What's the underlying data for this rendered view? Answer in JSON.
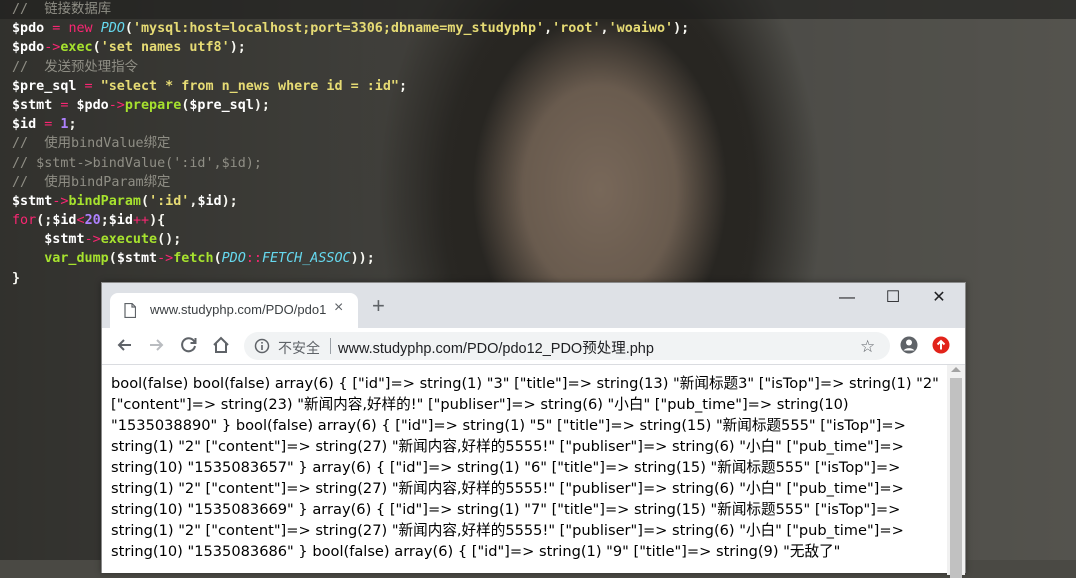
{
  "editor": {
    "lines": [
      [
        {
          "t": "//  链接数据库",
          "c": "cmt"
        }
      ],
      [
        {
          "t": "$pdo",
          "c": "var"
        },
        {
          "t": " = ",
          "c": "op"
        },
        {
          "t": "new ",
          "c": "kw"
        },
        {
          "t": "PDO",
          "c": "cls"
        },
        {
          "t": "(",
          "c": "pl"
        },
        {
          "t": "'mysql:host=localhost;port=3306;dbname=my_studyphp'",
          "c": "str"
        },
        {
          "t": ",",
          "c": "pl"
        },
        {
          "t": "'root'",
          "c": "str"
        },
        {
          "t": ",",
          "c": "pl"
        },
        {
          "t": "'woaiwo'",
          "c": "str"
        },
        {
          "t": ");",
          "c": "pl"
        }
      ],
      [
        {
          "t": "$pdo",
          "c": "var"
        },
        {
          "t": "->",
          "c": "op"
        },
        {
          "t": "exec",
          "c": "fn"
        },
        {
          "t": "(",
          "c": "pl"
        },
        {
          "t": "'set names utf8'",
          "c": "str"
        },
        {
          "t": ");",
          "c": "pl"
        }
      ],
      [
        {
          "t": "//  发送预处理指令",
          "c": "cmt"
        }
      ],
      [
        {
          "t": "$pre_sql",
          "c": "var"
        },
        {
          "t": " = ",
          "c": "op"
        },
        {
          "t": "\"select * from n_news where id = :id\"",
          "c": "str"
        },
        {
          "t": ";",
          "c": "pl"
        }
      ],
      [
        {
          "t": "$stmt",
          "c": "var"
        },
        {
          "t": " = ",
          "c": "op"
        },
        {
          "t": "$pdo",
          "c": "var"
        },
        {
          "t": "->",
          "c": "op"
        },
        {
          "t": "prepare",
          "c": "fn"
        },
        {
          "t": "(",
          "c": "pl"
        },
        {
          "t": "$pre_sql",
          "c": "var"
        },
        {
          "t": ");",
          "c": "pl"
        }
      ],
      [
        {
          "t": "$id",
          "c": "var"
        },
        {
          "t": " = ",
          "c": "op"
        },
        {
          "t": "1",
          "c": "num"
        },
        {
          "t": ";",
          "c": "pl"
        }
      ],
      [
        {
          "t": "//  使用bindValue绑定",
          "c": "cmt"
        }
      ],
      [
        {
          "t": "// $stmt->bindValue(':id',$id);",
          "c": "cmt"
        }
      ],
      [
        {
          "t": "//  使用bindParam绑定",
          "c": "cmt"
        }
      ],
      [
        {
          "t": "$stmt",
          "c": "var"
        },
        {
          "t": "->",
          "c": "op"
        },
        {
          "t": "bindParam",
          "c": "fn"
        },
        {
          "t": "(",
          "c": "pl"
        },
        {
          "t": "':id'",
          "c": "str"
        },
        {
          "t": ",",
          "c": "pl"
        },
        {
          "t": "$id",
          "c": "var"
        },
        {
          "t": ");",
          "c": "pl"
        }
      ],
      [
        {
          "t": "for",
          "c": "kw"
        },
        {
          "t": "(;",
          "c": "pl"
        },
        {
          "t": "$id",
          "c": "var"
        },
        {
          "t": "<",
          "c": "op"
        },
        {
          "t": "20",
          "c": "num"
        },
        {
          "t": ";",
          "c": "pl"
        },
        {
          "t": "$id",
          "c": "var"
        },
        {
          "t": "++",
          "c": "op"
        },
        {
          "t": "){",
          "c": "pl"
        }
      ],
      [
        {
          "t": "    ",
          "c": "pl"
        },
        {
          "t": "$stmt",
          "c": "var"
        },
        {
          "t": "->",
          "c": "op"
        },
        {
          "t": "execute",
          "c": "fn"
        },
        {
          "t": "();",
          "c": "pl"
        }
      ],
      [
        {
          "t": "    ",
          "c": "pl"
        },
        {
          "t": "var_dump",
          "c": "fn"
        },
        {
          "t": "(",
          "c": "pl"
        },
        {
          "t": "$stmt",
          "c": "var"
        },
        {
          "t": "->",
          "c": "op"
        },
        {
          "t": "fetch",
          "c": "fn"
        },
        {
          "t": "(",
          "c": "pl"
        },
        {
          "t": "PDO",
          "c": "cls"
        },
        {
          "t": "::",
          "c": "op"
        },
        {
          "t": "FETCH_ASSOC",
          "c": "cls"
        },
        {
          "t": "));",
          "c": "pl"
        }
      ],
      [
        {
          "t": "}",
          "c": "pl"
        }
      ]
    ]
  },
  "browser": {
    "tab_title": "www.studyphp.com/PDO/pdo1",
    "tab_close": "×",
    "new_tab": "+",
    "minimize": "—",
    "maximize": "☐",
    "close": "✕",
    "security_label": "不安全",
    "url": "www.studyphp.com/PDO/pdo12_PDO预处理.php",
    "star": "☆",
    "page_text": "bool(false) bool(false) array(6) { [\"id\"]=> string(1) \"3\" [\"title\"]=> string(13) \"新闻标题3\" [\"isTop\"]=> string(1) \"2\" [\"content\"]=> string(23) \"新闻内容,好样的!\" [\"publiser\"]=> string(6) \"小白\" [\"pub_time\"]=> string(10) \"1535038890\" } bool(false) array(6) { [\"id\"]=> string(1) \"5\" [\"title\"]=> string(15) \"新闻标题555\" [\"isTop\"]=> string(1) \"2\" [\"content\"]=> string(27) \"新闻内容,好样的5555!\" [\"publiser\"]=> string(6) \"小白\" [\"pub_time\"]=> string(10) \"1535083657\" } array(6) { [\"id\"]=> string(1) \"6\" [\"title\"]=> string(15) \"新闻标题555\" [\"isTop\"]=> string(1) \"2\" [\"content\"]=> string(27) \"新闻内容,好样的5555!\" [\"publiser\"]=> string(6) \"小白\" [\"pub_time\"]=> string(10) \"1535083669\" } array(6) { [\"id\"]=> string(1) \"7\" [\"title\"]=> string(15) \"新闻标题555\" [\"isTop\"]=> string(1) \"2\" [\"content\"]=> string(27) \"新闻内容,好样的5555!\" [\"publiser\"]=> string(6) \"小白\" [\"pub_time\"]=> string(10) \"1535083686\" } bool(false) array(6) { [\"id\"]=> string(1) \"9\" [\"title\"]=> string(9) \"无敌了\""
  }
}
